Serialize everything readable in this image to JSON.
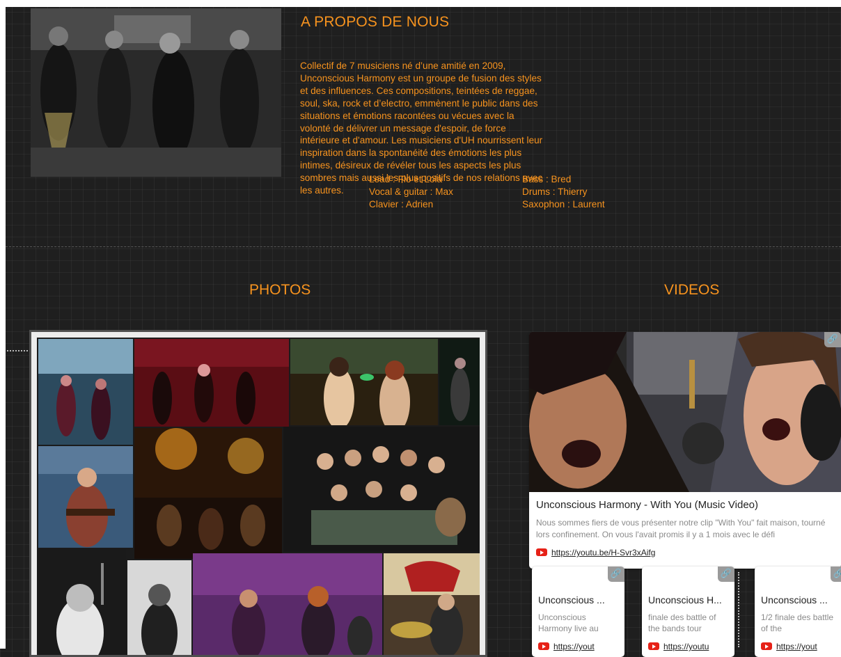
{
  "about": {
    "title": "A PROPOS DE NOUS",
    "description": "Collectif de 7 musiciens né d’une amitié en 2009, Unconscious Harmony est un groupe de fusion des styles et des influences. Ces compositions, teintées de reggae, soul, ska, rock et d’electro, emmènent le public dans des situations et émotions racontées ou vécues avec la volonté de délivrer un message d'espoir, de force intérieure et d'amour. Les musiciens d'UH nourrissent leur inspiration dans la spontanéité des émotions les plus intimes, désireux de révéler tous les aspects les plus sombres mais aussi les plus positifs de nos relations avec les autres.",
    "members_col1": [
      "Lead : Flo et Lola",
      "Vocal & guitar : Max",
      "Clavier : Adrien"
    ],
    "members_col2": [
      "Bass : Bred",
      "Drums : Thierry",
      "Saxophon : Laurent"
    ]
  },
  "photos": {
    "title": "PHOTOS"
  },
  "videos": {
    "title": "VIDEOS",
    "featured": {
      "title": "Unconscious Harmony - With You (Music Video)",
      "description": "Nous sommes fiers de vous présenter notre clip \"With You\" fait maison, tourné lors confinement. On vous l'avait promis il y a 1 mois avec le défi",
      "link": "https://youtu.be/H-Svr3xAifg",
      "link_icon": "link-icon"
    },
    "cards": [
      {
        "title": "Unconscious ...",
        "description": "Unconscious Harmony live au",
        "link": "https://yout"
      },
      {
        "title": "Unconscious H...",
        "description": "finale des battle of the bands tour",
        "link": "https://youtu"
      },
      {
        "title": "Unconscious ...",
        "description": "1/2 finale des battle of the",
        "link": "https://yout"
      }
    ]
  },
  "colors": {
    "accent": "#f7931e",
    "background": "#1f1f1f",
    "youtube": "#e62117"
  }
}
